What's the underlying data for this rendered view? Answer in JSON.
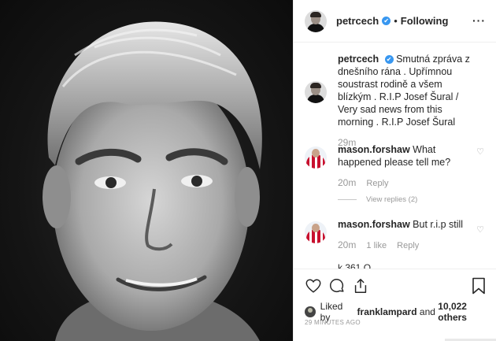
{
  "header": {
    "username": "petrcech",
    "verified_mark": "✔",
    "separator": "•",
    "follow_status": "Following",
    "more": "···"
  },
  "caption": {
    "username": "petrcech",
    "text": "Smutná zpráva z dnešního rána . Upřímnou soustrast rodině a všem blízkým . R.I.P Josef Šural / Very sad news from this morning . R.I.P Josef Šural",
    "time": "29m"
  },
  "comments": [
    {
      "username": "mason.forshaw",
      "text": "What happened please tell me?",
      "time": "20m",
      "likes": "",
      "reply": "Reply"
    },
    {
      "username": "mason.forshaw",
      "text": "But r.i.p still",
      "time": "20m",
      "likes": "1 like",
      "reply": "Reply"
    }
  ],
  "view_replies": "View replies (2)",
  "partial_comment": "k 361 O",
  "likes": {
    "prefix": "Liked by",
    "user": "franklampard",
    "conj": "and",
    "others": "10,022 others"
  },
  "timestamp": "29 MINUTES AGO",
  "colors": {
    "verified": "#3897f0",
    "muted": "#999999",
    "text": "#262626"
  },
  "icons": [
    "heart-icon",
    "comment-icon",
    "share-icon",
    "bookmark-icon",
    "more-icon"
  ]
}
